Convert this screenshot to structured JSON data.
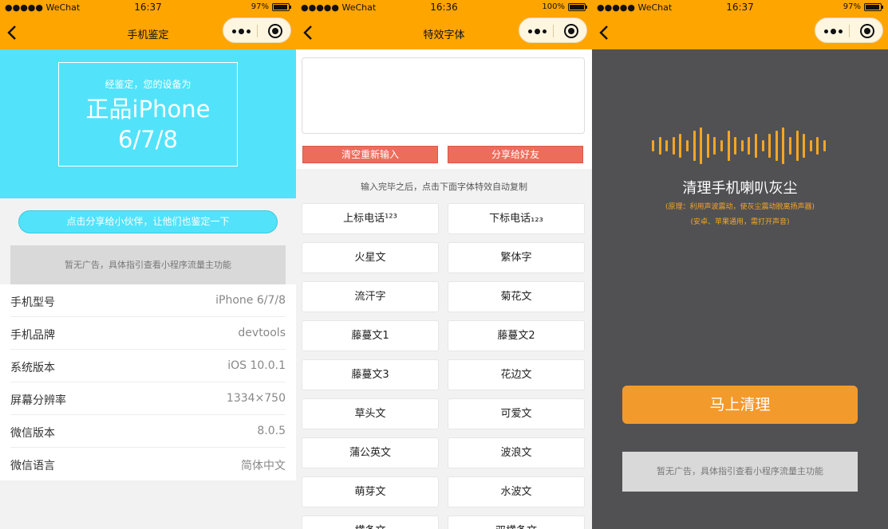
{
  "screens": [
    {
      "status": {
        "carrier": "●●●●● WeChat",
        "time": "16:37",
        "battery": "97%",
        "battery_level": 0.97
      },
      "nav": {
        "title": "手机鉴定"
      },
      "hero": {
        "subtitle": "经鉴定，您的设备为",
        "headline_1": "正品iPhone",
        "headline_2": "6/7/8"
      },
      "share_button": "点击分享给小伙伴，让他们也鉴定一下",
      "ad_text": "暂无广告，具体指引查看小程序流量主功能",
      "info_rows": [
        {
          "key": "手机型号",
          "value": "iPhone 6/7/8"
        },
        {
          "key": "手机品牌",
          "value": "devtools"
        },
        {
          "key": "系统版本",
          "value": "iOS 10.0.1"
        },
        {
          "key": "屏幕分辨率",
          "value": "1334×750"
        },
        {
          "key": "微信版本",
          "value": "8.0.5"
        },
        {
          "key": "微信语言",
          "value": "简体中文"
        }
      ]
    },
    {
      "status": {
        "carrier": "●●●●● WeChat",
        "time": "16:36",
        "battery": "100%",
        "battery_level": 1.0
      },
      "nav": {
        "title": "特效字体"
      },
      "input_value": "",
      "clear_button": "清空重新输入",
      "share_button": "分享给好友",
      "hint": "输入完毕之后，点击下面字体特效自动复制",
      "fonts": [
        "上标电话¹²³",
        "下标电话₁₂₃",
        "火星文",
        "繁体字",
        "流汗字",
        "菊花文",
        "藤蔓文1",
        "藤蔓文2",
        "藤蔓文3",
        "花边文",
        "草头文",
        "可爱文",
        "蒲公英文",
        "波浪文",
        "萌芽文",
        "水波文",
        "横条文",
        "双横条文"
      ]
    },
    {
      "status": {
        "carrier": "●●●●● WeChat",
        "time": "16:37",
        "battery": "97%",
        "battery_level": 0.97
      },
      "nav": {
        "title": ""
      },
      "title": "清理手机喇叭灰尘",
      "note_1": "(原理：利用声波震动，使灰尘震动脱离扬声器)",
      "note_2": "(安卓、苹果通用，需打开声音)",
      "clean_button": "马上清理",
      "ad_text": "暂无广告，具体指引查看小程序流量主功能"
    }
  ],
  "colors": {
    "nav": "#ffa500",
    "hero": "#52e3fb",
    "red_button": "#ed6d5b",
    "orange_button": "#f39a2c",
    "dark_bg": "#515154"
  },
  "icons": [
    "back-chevron-icon",
    "more-dots-icon",
    "close-target-icon",
    "wifi-icon",
    "battery-icon",
    "sound-wave-icon"
  ]
}
